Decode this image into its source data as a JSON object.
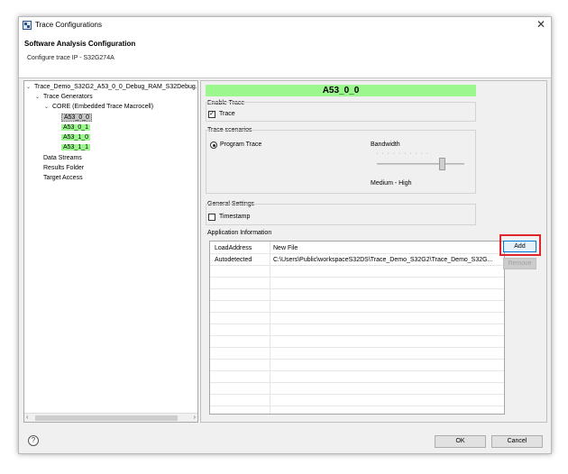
{
  "window": {
    "title": "Trace Configurations"
  },
  "header": {
    "title": "Software Analysis Configuration",
    "subtitle": "Configure trace IP - S32G274A"
  },
  "tree": {
    "root": "Trace_Demo_S32G2_A53_0_0_Debug_RAM_S32Debug.",
    "generators": "Trace Generators",
    "core": "CORE (Embedded Trace Macrocell)",
    "cores": [
      "A53_0_0",
      "A53_0_1",
      "A53_1_0",
      "A53_1_1"
    ],
    "others": [
      "Data Streams",
      "Results Folder",
      "Target Access"
    ]
  },
  "banner": "A53_0_0",
  "enable_trace": {
    "label": "Enable Trace",
    "checkbox_label": "Trace",
    "checked": true
  },
  "trace_scenarios": {
    "label": "Trace scenarios",
    "radio_label": "Program Trace",
    "bandwidth_label": "Bandwidth",
    "bandwidth_value": "Medium - High",
    "slider_position": 0.75
  },
  "general_settings": {
    "label": "General Settings",
    "timestamp_label": "Timestamp",
    "timestamp_checked": false
  },
  "application_info": {
    "label": "Application Information",
    "rows": [
      {
        "key": "LoadAddress",
        "value": "New File"
      },
      {
        "key": "Autodetected",
        "value": "C:\\Users\\Public\\workspaceS32DS\\Trace_Demo_S32G2\\Trace_Demo_S32G..."
      }
    ]
  },
  "buttons": {
    "add": "Add",
    "remove": "Remove",
    "ok": "OK",
    "cancel": "Cancel"
  },
  "icons": {
    "help": "?",
    "close": "✕"
  }
}
